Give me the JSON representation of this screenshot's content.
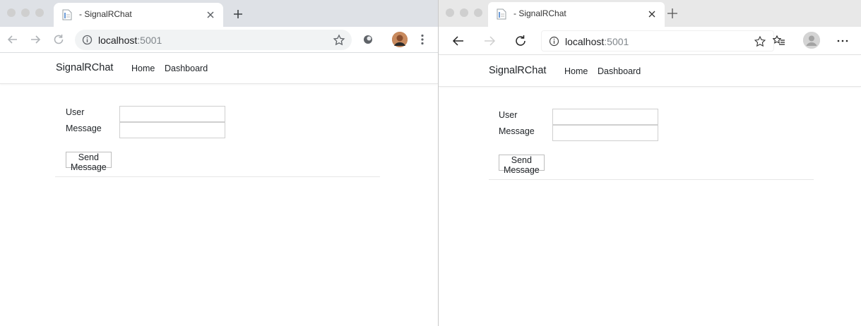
{
  "windows": [
    {
      "browser": "chrome",
      "tab": {
        "title": "- SignalRChat"
      },
      "address": {
        "host": "localhost",
        "port": ":5001"
      }
    },
    {
      "browser": "edge",
      "tab": {
        "title": "- SignalRChat"
      },
      "address": {
        "host": "localhost",
        "port": ":5001"
      }
    }
  ],
  "app": {
    "brand": "SignalRChat",
    "nav": {
      "home": "Home",
      "dashboard": "Dashboard"
    },
    "form": {
      "user_label": "User",
      "message_label": "Message",
      "user_value": "",
      "message_value": "",
      "send_label": "Send Message"
    }
  },
  "icons": {
    "back": "arrow-left-icon",
    "forward": "arrow-right-icon",
    "reload": "reload-icon",
    "info": "info-icon",
    "bookmark": "star-icon",
    "extension": "extension-icon",
    "avatar": "profile-avatar",
    "menu": "more-vertical-icon",
    "favorites": "favorites-icon",
    "more": "more-horizontal-icon",
    "close": "close-icon",
    "new_tab": "plus-icon"
  },
  "colors": {
    "chrome_tabstrip": "#dee1e6",
    "edge_tabstrip": "#e8e8e8",
    "omnibox": "#f1f3f4",
    "text": "#212529"
  }
}
